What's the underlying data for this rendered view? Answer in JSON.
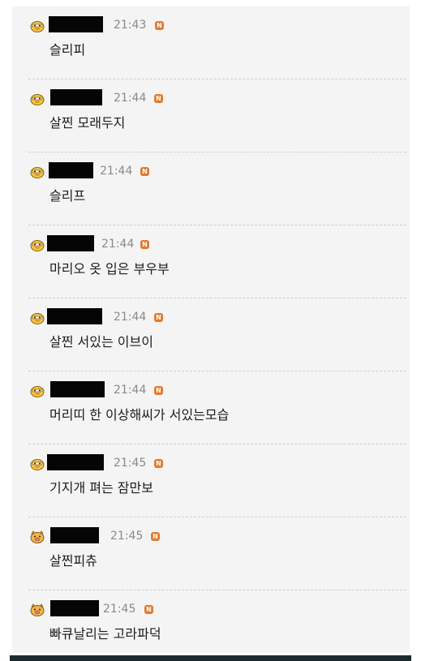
{
  "comments": [
    {
      "time": "21:43",
      "badge": "N",
      "text": "슬리피",
      "avatar_icon": "duck-face-icon"
    },
    {
      "time": "21:44",
      "badge": "N",
      "text": "살찐 모래두지",
      "avatar_icon": "duck-face-icon"
    },
    {
      "time": "21:44",
      "badge": "N",
      "text": "슬리프",
      "avatar_icon": "duck-face-icon"
    },
    {
      "time": "21:44",
      "badge": "N",
      "text": "마리오 옷 입은 부우부",
      "avatar_icon": "duck-face-icon"
    },
    {
      "time": "21:44",
      "badge": "N",
      "text": "살찐 서있는 이브이",
      "avatar_icon": "duck-face-icon"
    },
    {
      "time": "21:44",
      "badge": "N",
      "text": "머리띠 한 이상해씨가 서있는모습",
      "avatar_icon": "duck-face-icon"
    },
    {
      "time": "21:45",
      "badge": "N",
      "text": "기지개 펴는 잠만보",
      "avatar_icon": "duck-face-icon"
    },
    {
      "time": "21:45",
      "badge": "N",
      "text": "살찐피츄",
      "avatar_icon": "pig-face-icon"
    },
    {
      "time": "21:45",
      "badge": "N",
      "text": "빠큐날리는 고라파덕",
      "avatar_icon": "pig-face-icon"
    }
  ],
  "colors": {
    "panel_background": "#f4f4f4",
    "badge": "#e27a2e",
    "timestamp": "#8a8a8a",
    "redaction": "#050505",
    "bottom_bar": "#1d2b2f"
  }
}
